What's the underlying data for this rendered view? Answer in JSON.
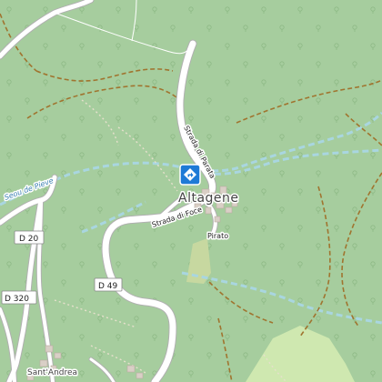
{
  "map": {
    "places": {
      "altagene": "Altagene",
      "santandrea": "Sant'Andrea"
    },
    "streets": {
      "strada_di_parata": "Strada di Parata",
      "strada_di_foce": "Strada di Foce",
      "pirato": "Pirato"
    },
    "waterways": {
      "stream": "Seou de Pieve"
    },
    "road_refs": {
      "d20": "D 20",
      "d320": "D 320",
      "d49": "D 49"
    },
    "poi": {
      "marker_icon": "direction-sign-icon",
      "marker_color": "#1e7ad6"
    },
    "colors": {
      "forest": "#a6cd9e",
      "clearing": "#cfe8b0",
      "road": "#ffffff",
      "road_casing": "#b0b0b0",
      "track": "#a0742f",
      "footpath": "#e6e0cc",
      "stream": "#a9d6e0"
    }
  }
}
